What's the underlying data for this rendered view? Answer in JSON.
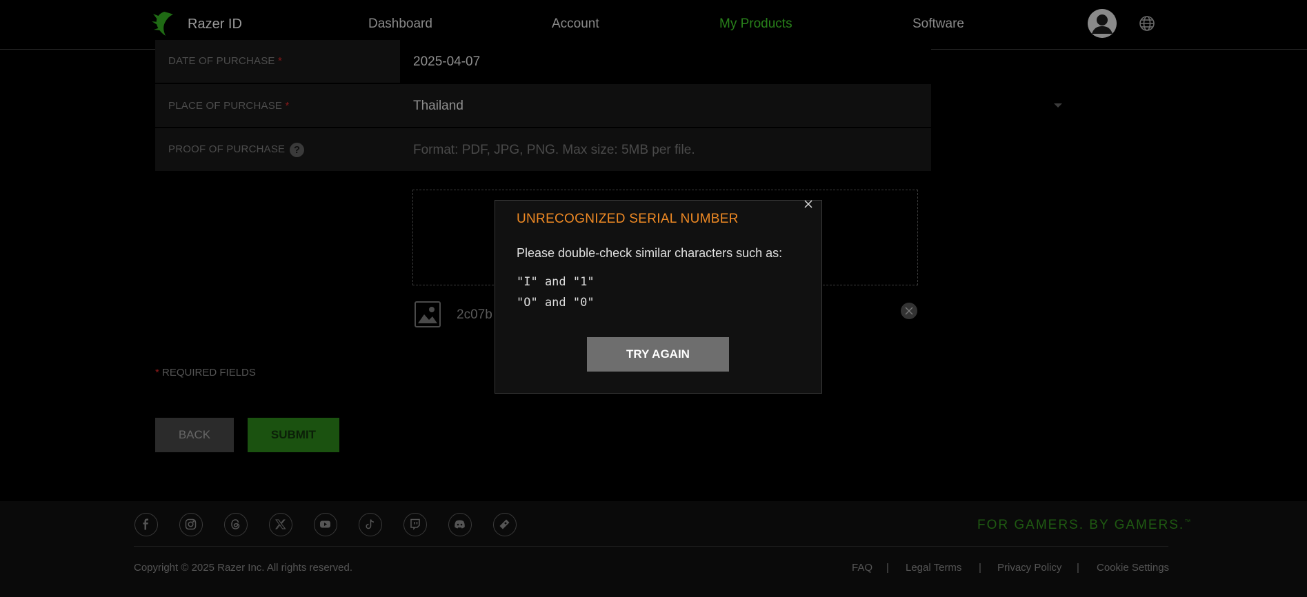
{
  "header": {
    "brand": "Razer ID",
    "nav": [
      {
        "label": "Dashboard"
      },
      {
        "label": "Account"
      },
      {
        "label": "My Products"
      },
      {
        "label": "Software"
      }
    ]
  },
  "form": {
    "date_label": "DATE OF PURCHASE",
    "date_value": "2025-04-07",
    "place_label": "PLACE OF PURCHASE",
    "place_value": "Thailand",
    "proof_label": "PROOF OF PURCHASE",
    "proof_hint": "Format: PDF, JPG, PNG. Max size: 5MB per file.",
    "required_mark": "*",
    "file_name": "2c07b",
    "required_note": "REQUIRED FIELDS",
    "back_label": "BACK",
    "submit_label": "SUBMIT"
  },
  "modal": {
    "title": "UNRECOGNIZED SERIAL NUMBER",
    "text": "Please double-check similar characters such as:",
    "line1": "\"I\" and \"1\"",
    "line2": "\"O\" and \"0\"",
    "button": "TRY AGAIN"
  },
  "footer": {
    "social": [
      "facebook-icon",
      "instagram-icon",
      "threads-icon",
      "x-icon",
      "youtube-icon",
      "tiktok-icon",
      "twitch-icon",
      "discord-icon",
      "razer-gold-icon"
    ],
    "tagline": "FOR GAMERS. BY GAMERS.",
    "tagline_tm": "™",
    "copyright": "Copyright © 2025 Razer Inc. All rights reserved.",
    "links": [
      "FAQ",
      "Legal Terms",
      "Privacy Policy",
      "Cookie Settings"
    ],
    "separator": "|"
  },
  "colors": {
    "accent_green": "#44d62c",
    "modal_title": "#f08a24"
  }
}
